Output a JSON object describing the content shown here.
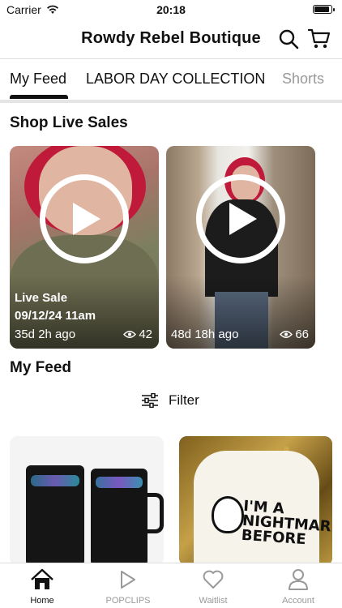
{
  "status": {
    "carrier": "Carrier",
    "time": "20:18"
  },
  "header": {
    "title": "Rowdy Rebel Boutique"
  },
  "tabs": [
    {
      "label": "My Feed",
      "active": true
    },
    {
      "label": "LABOR DAY COLLECTION",
      "active": false
    },
    {
      "label": "Shorts",
      "active": false
    }
  ],
  "live_sales": {
    "title": "Shop Live Sales",
    "items": [
      {
        "label_1": "Live Sale",
        "label_2": "09/12/24 11am",
        "age": "35d 2h ago",
        "views": "42"
      },
      {
        "age": "48d 18h ago",
        "views": "66"
      }
    ]
  },
  "feed": {
    "title": "My Feed",
    "filter_label": "Filter"
  },
  "bottom_nav": [
    {
      "label": "Home",
      "icon": "home-icon",
      "active": true
    },
    {
      "label": "POPCLIPS",
      "icon": "play-icon",
      "active": false
    },
    {
      "label": "Waitlist",
      "icon": "heart-icon",
      "active": false
    },
    {
      "label": "Account",
      "icon": "person-icon",
      "active": false
    }
  ],
  "colors": {
    "text": "#111111",
    "inactive": "#999999",
    "divider": "#dddddd"
  }
}
